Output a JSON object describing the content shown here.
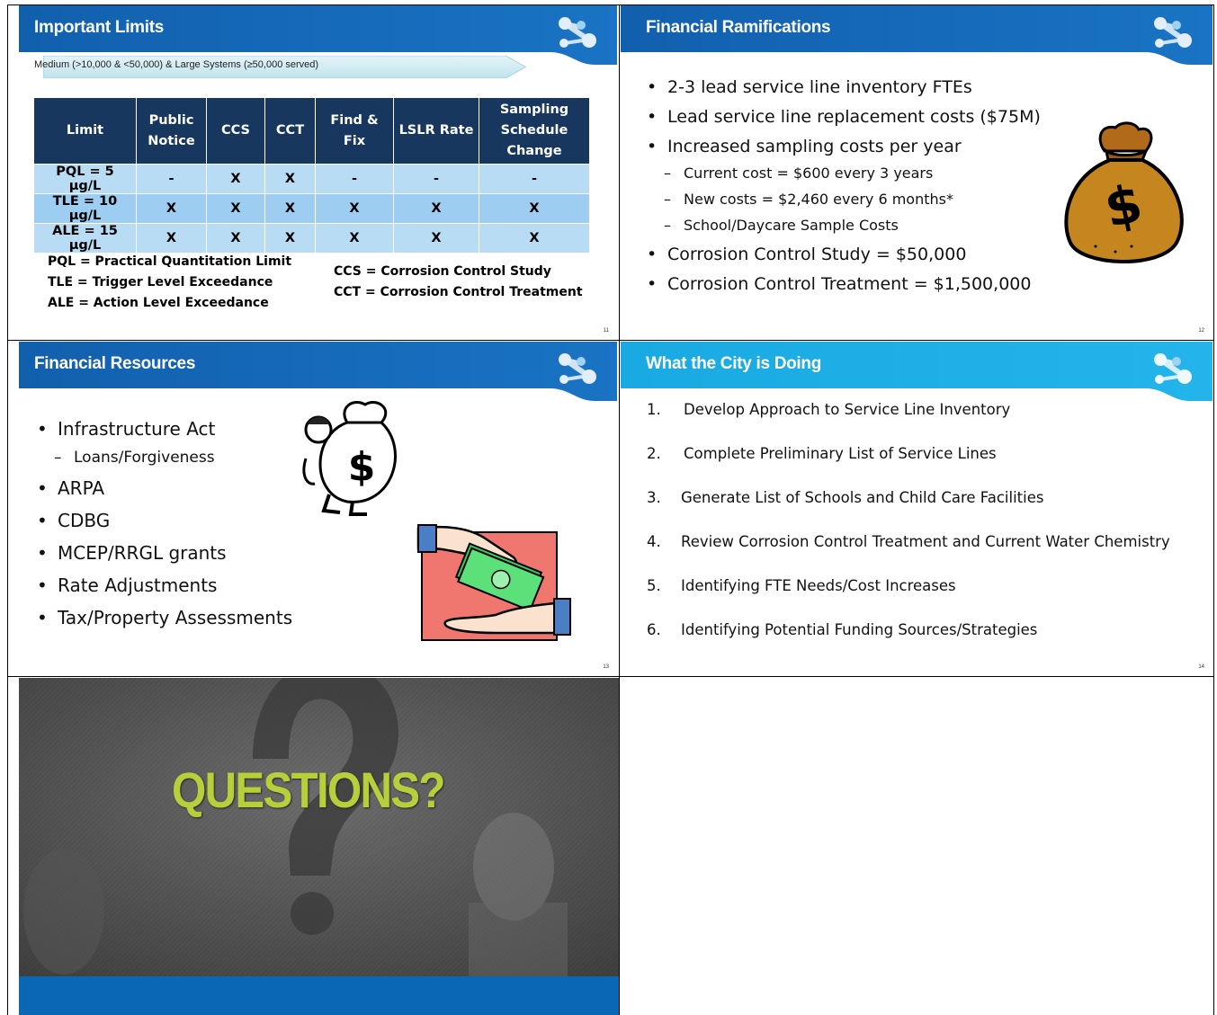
{
  "slides": {
    "important_limits": {
      "title": "Important Limits",
      "subtitle": "Medium (>10,000 & <50,000) & Large Systems (≥50,000 served)",
      "page": "11",
      "table": {
        "headers": [
          "Limit",
          "Public Notice",
          "CCS",
          "CCT",
          "Find & Fix",
          "LSLR Rate",
          "Sampling Schedule Change"
        ],
        "rows": [
          [
            "PQL = 5 µg/L",
            "-",
            "X",
            "X",
            "-",
            "-",
            "-"
          ],
          [
            "TLE = 10 µg/L",
            "X",
            "X",
            "X",
            "X",
            "X",
            "X"
          ],
          [
            "ALE = 15 µg/L",
            "X",
            "X",
            "X",
            "X",
            "X",
            "X"
          ]
        ]
      },
      "defs_left": [
        "PQL = Practical Quantitation Limit",
        "TLE = Trigger Level Exceedance",
        "ALE = Action Level Exceedance"
      ],
      "defs_right": [
        "CCS = Corrosion Control Study",
        "CCT = Corrosion Control Treatment"
      ]
    },
    "financial_ramifications": {
      "title": "Financial Ramifications",
      "page": "12",
      "items": [
        {
          "level": 1,
          "text": "2-3 lead service line inventory FTEs"
        },
        {
          "level": 1,
          "text": "Lead service line replacement costs ($75M)"
        },
        {
          "level": 1,
          "text": "Increased sampling costs per year"
        },
        {
          "level": 2,
          "text": "Current cost = $600 every 3 years"
        },
        {
          "level": 2,
          "text": "New costs = $2,460 every 6 months*"
        },
        {
          "level": 2,
          "text": "School/Daycare Sample Costs"
        },
        {
          "level": 1,
          "text": "Corrosion Control Study = $50,000"
        },
        {
          "level": 1,
          "text": "Corrosion Control Treatment = $1,500,000"
        }
      ],
      "image": "money-bag-icon"
    },
    "financial_resources": {
      "title": "Financial Resources",
      "page": "13",
      "items": [
        {
          "level": 1,
          "text": "Infrastructure Act"
        },
        {
          "level": 2,
          "text": "Loans/Forgiveness"
        },
        {
          "level": 1,
          "text": "ARPA"
        },
        {
          "level": 1,
          "text": "CDBG"
        },
        {
          "level": 1,
          "text": "MCEP/RRGL grants"
        },
        {
          "level": 1,
          "text": "Rate Adjustments"
        },
        {
          "level": 1,
          "text": "Tax/Property Assessments"
        }
      ]
    },
    "city_doing": {
      "title": "What the City is Doing",
      "page": "14",
      "steps": [
        {
          "num": "1.",
          "text": "Develop Approach to Service Line Inventory"
        },
        {
          "num": "2.",
          "text": "Complete Preliminary List of Service Lines"
        },
        {
          "num": "3.",
          "text": "Generate List of Schools and Child Care Facilities"
        },
        {
          "num": "4.",
          "text": "Review Corrosion Control Treatment and Current Water Chemistry"
        },
        {
          "num": "5.",
          "text": "Identifying FTE Needs/Cost Increases"
        },
        {
          "num": "6.",
          "text": "Identifying Potential Funding Sources/Strategies"
        }
      ]
    },
    "questions": {
      "title": "QUESTIONS?"
    }
  },
  "colors": {
    "header_dark_blue": "#1565b3",
    "header_light_blue": "#1aa9e0",
    "table_header": "#17375e",
    "questions_text": "#b7cf3a",
    "footer_blue": "#0a67b5"
  }
}
